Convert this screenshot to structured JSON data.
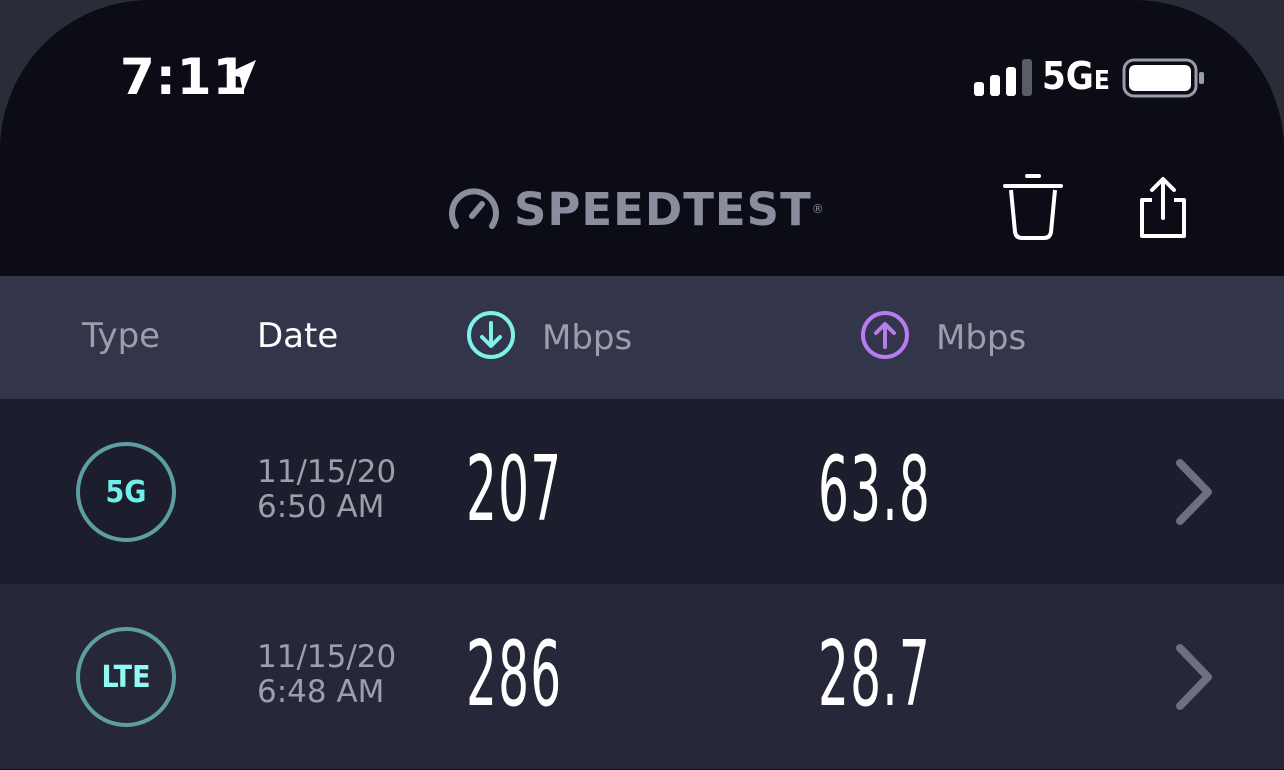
{
  "status_bar": {
    "time": "7:11",
    "network": "5G",
    "network_suffix": "E"
  },
  "header": {
    "logo_text": "SPEEDTEST",
    "logo_tm": "®"
  },
  "columns": {
    "type": "Type",
    "date": "Date",
    "download": "Mbps",
    "upload": "Mbps"
  },
  "results": [
    {
      "type": "5G",
      "date": "11/15/20",
      "time": "6:50 AM",
      "download": "207",
      "upload": "63.8"
    },
    {
      "type": "LTE",
      "date": "11/15/20",
      "time": "6:48 AM",
      "download": "286",
      "upload": "28.7"
    }
  ],
  "colors": {
    "download_accent": "#7ef2ea",
    "upload_accent": "#b77cf0",
    "badge_ring": "#5e9ea2"
  }
}
